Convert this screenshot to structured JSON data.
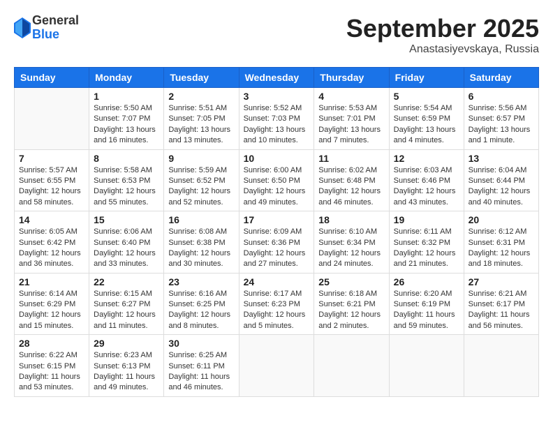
{
  "logo": {
    "general": "General",
    "blue": "Blue"
  },
  "title": "September 2025",
  "subtitle": "Anastasiyevskaya, Russia",
  "headers": [
    "Sunday",
    "Monday",
    "Tuesday",
    "Wednesday",
    "Thursday",
    "Friday",
    "Saturday"
  ],
  "weeks": [
    [
      {
        "day": "",
        "sunrise": "",
        "sunset": "",
        "daylight": ""
      },
      {
        "day": "1",
        "sunrise": "Sunrise: 5:50 AM",
        "sunset": "Sunset: 7:07 PM",
        "daylight": "Daylight: 13 hours and 16 minutes."
      },
      {
        "day": "2",
        "sunrise": "Sunrise: 5:51 AM",
        "sunset": "Sunset: 7:05 PM",
        "daylight": "Daylight: 13 hours and 13 minutes."
      },
      {
        "day": "3",
        "sunrise": "Sunrise: 5:52 AM",
        "sunset": "Sunset: 7:03 PM",
        "daylight": "Daylight: 13 hours and 10 minutes."
      },
      {
        "day": "4",
        "sunrise": "Sunrise: 5:53 AM",
        "sunset": "Sunset: 7:01 PM",
        "daylight": "Daylight: 13 hours and 7 minutes."
      },
      {
        "day": "5",
        "sunrise": "Sunrise: 5:54 AM",
        "sunset": "Sunset: 6:59 PM",
        "daylight": "Daylight: 13 hours and 4 minutes."
      },
      {
        "day": "6",
        "sunrise": "Sunrise: 5:56 AM",
        "sunset": "Sunset: 6:57 PM",
        "daylight": "Daylight: 13 hours and 1 minute."
      }
    ],
    [
      {
        "day": "7",
        "sunrise": "Sunrise: 5:57 AM",
        "sunset": "Sunset: 6:55 PM",
        "daylight": "Daylight: 12 hours and 58 minutes."
      },
      {
        "day": "8",
        "sunrise": "Sunrise: 5:58 AM",
        "sunset": "Sunset: 6:53 PM",
        "daylight": "Daylight: 12 hours and 55 minutes."
      },
      {
        "day": "9",
        "sunrise": "Sunrise: 5:59 AM",
        "sunset": "Sunset: 6:52 PM",
        "daylight": "Daylight: 12 hours and 52 minutes."
      },
      {
        "day": "10",
        "sunrise": "Sunrise: 6:00 AM",
        "sunset": "Sunset: 6:50 PM",
        "daylight": "Daylight: 12 hours and 49 minutes."
      },
      {
        "day": "11",
        "sunrise": "Sunrise: 6:02 AM",
        "sunset": "Sunset: 6:48 PM",
        "daylight": "Daylight: 12 hours and 46 minutes."
      },
      {
        "day": "12",
        "sunrise": "Sunrise: 6:03 AM",
        "sunset": "Sunset: 6:46 PM",
        "daylight": "Daylight: 12 hours and 43 minutes."
      },
      {
        "day": "13",
        "sunrise": "Sunrise: 6:04 AM",
        "sunset": "Sunset: 6:44 PM",
        "daylight": "Daylight: 12 hours and 40 minutes."
      }
    ],
    [
      {
        "day": "14",
        "sunrise": "Sunrise: 6:05 AM",
        "sunset": "Sunset: 6:42 PM",
        "daylight": "Daylight: 12 hours and 36 minutes."
      },
      {
        "day": "15",
        "sunrise": "Sunrise: 6:06 AM",
        "sunset": "Sunset: 6:40 PM",
        "daylight": "Daylight: 12 hours and 33 minutes."
      },
      {
        "day": "16",
        "sunrise": "Sunrise: 6:08 AM",
        "sunset": "Sunset: 6:38 PM",
        "daylight": "Daylight: 12 hours and 30 minutes."
      },
      {
        "day": "17",
        "sunrise": "Sunrise: 6:09 AM",
        "sunset": "Sunset: 6:36 PM",
        "daylight": "Daylight: 12 hours and 27 minutes."
      },
      {
        "day": "18",
        "sunrise": "Sunrise: 6:10 AM",
        "sunset": "Sunset: 6:34 PM",
        "daylight": "Daylight: 12 hours and 24 minutes."
      },
      {
        "day": "19",
        "sunrise": "Sunrise: 6:11 AM",
        "sunset": "Sunset: 6:32 PM",
        "daylight": "Daylight: 12 hours and 21 minutes."
      },
      {
        "day": "20",
        "sunrise": "Sunrise: 6:12 AM",
        "sunset": "Sunset: 6:31 PM",
        "daylight": "Daylight: 12 hours and 18 minutes."
      }
    ],
    [
      {
        "day": "21",
        "sunrise": "Sunrise: 6:14 AM",
        "sunset": "Sunset: 6:29 PM",
        "daylight": "Daylight: 12 hours and 15 minutes."
      },
      {
        "day": "22",
        "sunrise": "Sunrise: 6:15 AM",
        "sunset": "Sunset: 6:27 PM",
        "daylight": "Daylight: 12 hours and 11 minutes."
      },
      {
        "day": "23",
        "sunrise": "Sunrise: 6:16 AM",
        "sunset": "Sunset: 6:25 PM",
        "daylight": "Daylight: 12 hours and 8 minutes."
      },
      {
        "day": "24",
        "sunrise": "Sunrise: 6:17 AM",
        "sunset": "Sunset: 6:23 PM",
        "daylight": "Daylight: 12 hours and 5 minutes."
      },
      {
        "day": "25",
        "sunrise": "Sunrise: 6:18 AM",
        "sunset": "Sunset: 6:21 PM",
        "daylight": "Daylight: 12 hours and 2 minutes."
      },
      {
        "day": "26",
        "sunrise": "Sunrise: 6:20 AM",
        "sunset": "Sunset: 6:19 PM",
        "daylight": "Daylight: 11 hours and 59 minutes."
      },
      {
        "day": "27",
        "sunrise": "Sunrise: 6:21 AM",
        "sunset": "Sunset: 6:17 PM",
        "daylight": "Daylight: 11 hours and 56 minutes."
      }
    ],
    [
      {
        "day": "28",
        "sunrise": "Sunrise: 6:22 AM",
        "sunset": "Sunset: 6:15 PM",
        "daylight": "Daylight: 11 hours and 53 minutes."
      },
      {
        "day": "29",
        "sunrise": "Sunrise: 6:23 AM",
        "sunset": "Sunset: 6:13 PM",
        "daylight": "Daylight: 11 hours and 49 minutes."
      },
      {
        "day": "30",
        "sunrise": "Sunrise: 6:25 AM",
        "sunset": "Sunset: 6:11 PM",
        "daylight": "Daylight: 11 hours and 46 minutes."
      },
      {
        "day": "",
        "sunrise": "",
        "sunset": "",
        "daylight": ""
      },
      {
        "day": "",
        "sunrise": "",
        "sunset": "",
        "daylight": ""
      },
      {
        "day": "",
        "sunrise": "",
        "sunset": "",
        "daylight": ""
      },
      {
        "day": "",
        "sunrise": "",
        "sunset": "",
        "daylight": ""
      }
    ]
  ]
}
